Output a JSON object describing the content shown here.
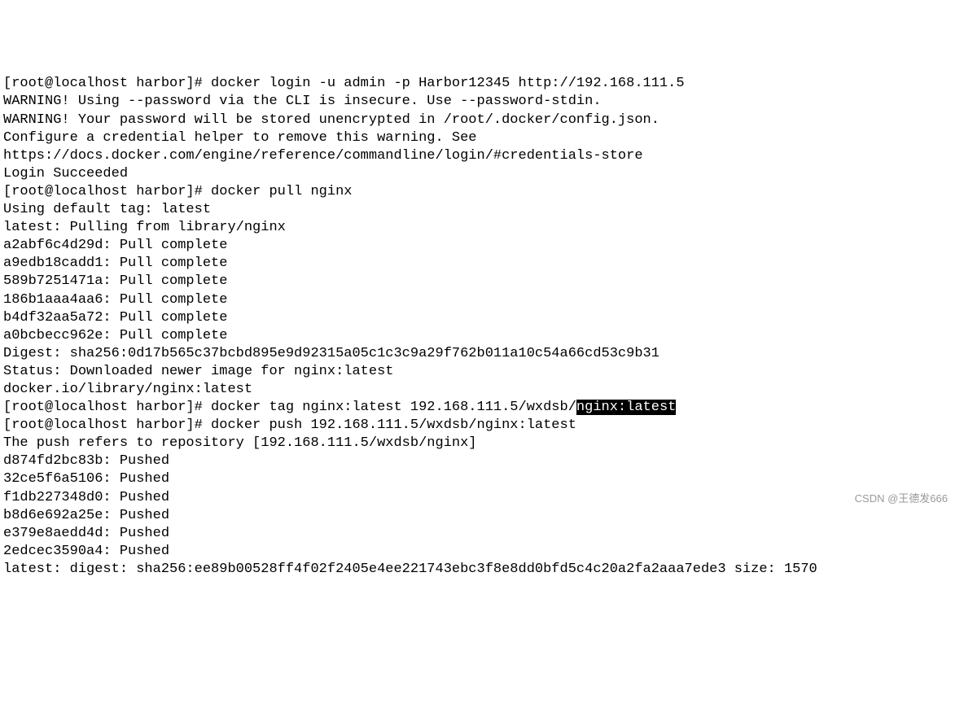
{
  "terminal": {
    "lines": [
      "[root@localhost harbor]# docker login -u admin -p Harbor12345 http://192.168.111.5",
      "WARNING! Using --password via the CLI is insecure. Use --password-stdin.",
      "WARNING! Your password will be stored unencrypted in /root/.docker/config.json.",
      "Configure a credential helper to remove this warning. See",
      "https://docs.docker.com/engine/reference/commandline/login/#credentials-store",
      "",
      "Login Succeeded",
      "[root@localhost harbor]# docker pull nginx",
      "Using default tag: latest",
      "latest: Pulling from library/nginx",
      "a2abf6c4d29d: Pull complete",
      "a9edb18cadd1: Pull complete",
      "589b7251471a: Pull complete",
      "186b1aaa4aa6: Pull complete",
      "b4df32aa5a72: Pull complete",
      "a0bcbecc962e: Pull complete",
      "Digest: sha256:0d17b565c37bcbd895e9d92315a05c1c3c9a29f762b011a10c54a66cd53c9b31",
      "Status: Downloaded newer image for nginx:latest",
      "docker.io/library/nginx:latest"
    ],
    "tag_line_prefix": "[root@localhost harbor]# docker tag nginx:latest 192.168.111.5/wxdsb/",
    "tag_line_highlight": "nginx:latest",
    "lines_after": [
      "[root@localhost harbor]# docker push 192.168.111.5/wxdsb/nginx:latest",
      "The push refers to repository [192.168.111.5/wxdsb/nginx]",
      "d874fd2bc83b: Pushed",
      "32ce5f6a5106: Pushed",
      "f1db227348d0: Pushed",
      "b8d6e692a25e: Pushed",
      "e379e8aedd4d: Pushed",
      "2edcec3590a4: Pushed",
      "latest: digest: sha256:ee89b00528ff4f02f2405e4ee221743ebc3f8e8dd0bfd5c4c20a2fa2aaa7ede3 size: 1570"
    ]
  },
  "watermark": "CSDN @王德发666"
}
